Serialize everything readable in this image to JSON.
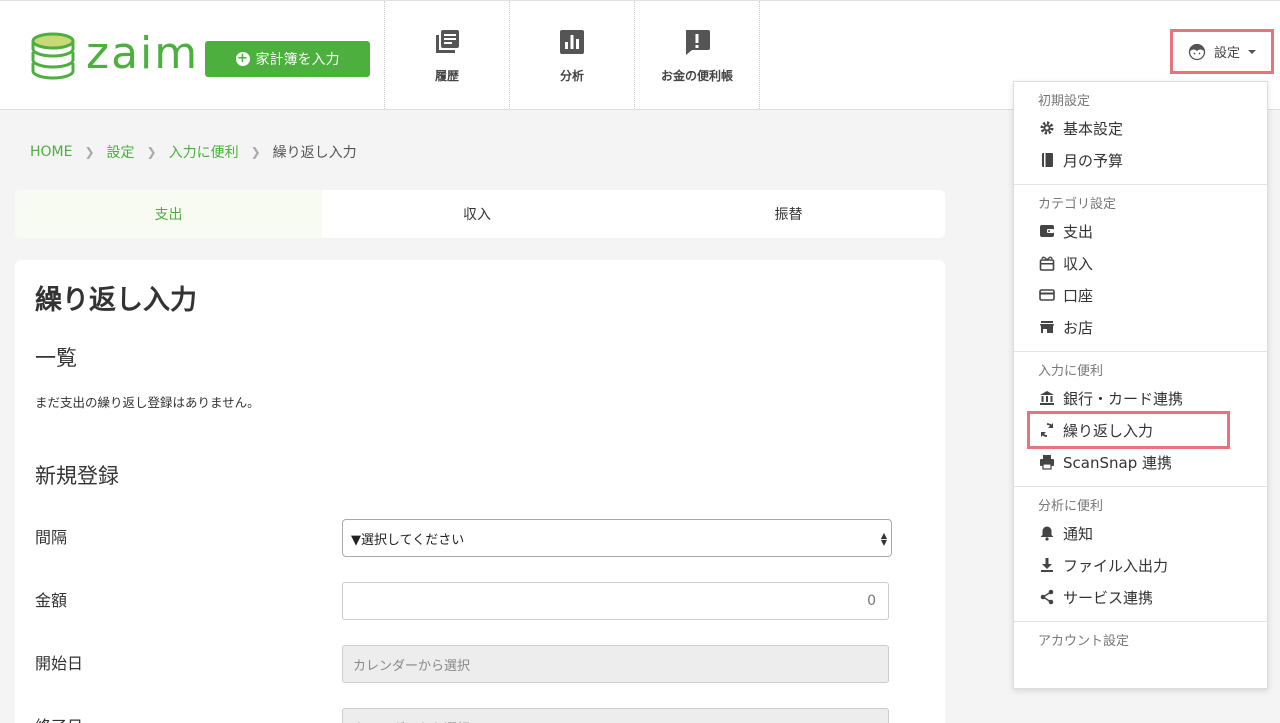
{
  "header": {
    "logo_text": "zaim",
    "entry_button": "家計簿を入力",
    "nav": [
      {
        "label": "履歴",
        "icon": "history-icon"
      },
      {
        "label": "分析",
        "icon": "analysis-icon"
      },
      {
        "label": "お金の便利帳",
        "icon": "money-guide-icon"
      }
    ],
    "settings_label": "設定"
  },
  "breadcrumb": {
    "home": "HOME",
    "settings": "設定",
    "convenient": "入力に便利",
    "current": "繰り返し入力"
  },
  "tabs": [
    {
      "label": "支出",
      "active": true
    },
    {
      "label": "収入",
      "active": false
    },
    {
      "label": "振替",
      "active": false
    }
  ],
  "main": {
    "title": "繰り返し入力",
    "list_heading": "一覧",
    "empty_note": "まだ支出の繰り返し登録はありません。",
    "new_heading": "新規登録",
    "fields": {
      "interval_label": "間隔",
      "interval_value": "▼選択してください",
      "amount_label": "金額",
      "amount_value": "0",
      "start_label": "開始日",
      "start_placeholder": "カレンダーから選択",
      "end_label": "終了日",
      "end_placeholder": "カレンダーから選択"
    }
  },
  "dropdown": {
    "sections": [
      {
        "heading": "初期設定",
        "items": [
          {
            "label": "基本設定",
            "icon": "gear-icon"
          },
          {
            "label": "月の予算",
            "icon": "book-icon"
          }
        ]
      },
      {
        "heading": "カテゴリ設定",
        "items": [
          {
            "label": "支出",
            "icon": "wallet-icon"
          },
          {
            "label": "収入",
            "icon": "gift-icon"
          },
          {
            "label": "口座",
            "icon": "card-icon"
          },
          {
            "label": "お店",
            "icon": "store-icon"
          }
        ]
      },
      {
        "heading": "入力に便利",
        "items": [
          {
            "label": "銀行・カード連携",
            "icon": "bank-icon"
          },
          {
            "label": "繰り返し入力",
            "icon": "repeat-icon",
            "highlight": true
          },
          {
            "label": "ScanSnap 連携",
            "icon": "printer-icon"
          }
        ]
      },
      {
        "heading": "分析に便利",
        "items": [
          {
            "label": "通知",
            "icon": "bell-icon"
          },
          {
            "label": "ファイル入出力",
            "icon": "download-icon"
          },
          {
            "label": "サービス連携",
            "icon": "share-icon"
          }
        ]
      },
      {
        "heading": "アカウント設定",
        "items": []
      }
    ]
  },
  "colors": {
    "brand_green": "#4caf3e",
    "highlight_red": "#e8737c"
  }
}
